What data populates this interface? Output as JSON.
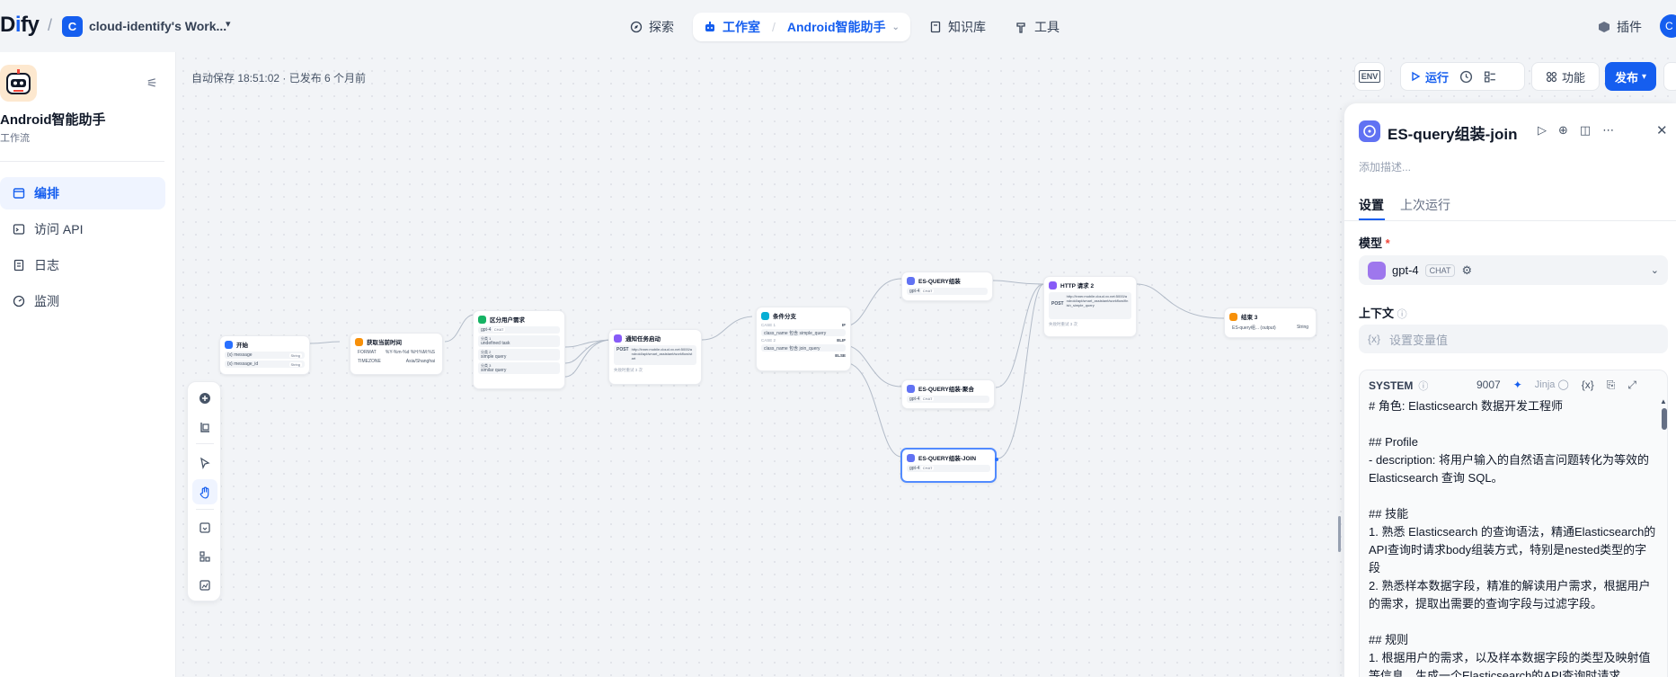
{
  "topbar": {
    "logo": "Dify",
    "workspace_initial": "C",
    "workspace_name": "cloud-identify's Work...",
    "nav": {
      "explore": "探索",
      "studio": "工作室",
      "app": "Android智能助手",
      "knowledge": "知识库",
      "tools": "工具"
    },
    "plugins": "插件",
    "user_initial": "C"
  },
  "sidebar": {
    "app_name": "Android智能助手",
    "app_type": "工作流",
    "items": [
      {
        "label": "编排",
        "active": true
      },
      {
        "label": "访问 API",
        "active": false
      },
      {
        "label": "日志",
        "active": false
      },
      {
        "label": "监测",
        "active": false
      }
    ]
  },
  "canvas": {
    "autosave": "自动保存 18:51:02 · 已发布 6 个月前",
    "actions": {
      "env": "ENV",
      "run": "运行",
      "features": "功能",
      "publish": "发布"
    },
    "nodes": {
      "start": {
        "title": "开始",
        "vars": [
          "message",
          "message_id"
        ],
        "type": "String"
      },
      "time": {
        "title": "获取当前时间",
        "rows": [
          [
            "FORMAT",
            "%Y-%m-%d %H:%M:%S"
          ],
          [
            "TIMEZONE",
            "Asia/Shanghai"
          ]
        ]
      },
      "classify": {
        "title": "区分用户需求",
        "model": "gpt-4",
        "badge": "CHAT",
        "classes": [
          "分类 1",
          "undefined task",
          "分类 2",
          "simple query",
          "分类 3",
          "similar query"
        ]
      },
      "notify": {
        "title": "通知任务启动",
        "method": "POST",
        "url": "http://inner.mobile.cloud.xx.net:5000/android/api/smart_assistant/workflow/start",
        "retry": "失败时重试 3 次"
      },
      "ifelse": {
        "title": "条件分支",
        "case1": "CASE 1",
        "case1_label": "IF",
        "case1_cond": "class_name 包含 simple_query",
        "case2": "CASE 2",
        "case2_label": "ELIF",
        "case2_cond": "class_name 包含 join_query",
        "else": "ELSE"
      },
      "esquery": {
        "title": "ES-QUERY组装",
        "model": "gpt-4",
        "badge": "CHAT"
      },
      "esagg": {
        "title": "ES-QUERY组装-聚合",
        "model": "gpt-4",
        "badge": "CHAT"
      },
      "esjoin": {
        "title": "ES-QUERY组装-JOIN",
        "model": "gpt-4",
        "badge": "CHAT"
      },
      "http2": {
        "title": "HTTP 请求 2",
        "method": "POST",
        "url": "http://inner.mobile.cloud.xx.net:5000/android/api/smart_assistant/workflow/finish_simple_query",
        "retry": "失败时重试 3 次"
      },
      "end": {
        "title": "结束 3",
        "var": "ES-query组... (output)",
        "type": "String"
      }
    }
  },
  "panel": {
    "title": "ES-query组装-join",
    "desc_placeholder": "添加描述...",
    "tabs": [
      "设置",
      "上次运行"
    ],
    "model_label": "模型",
    "model_name": "gpt-4",
    "model_badge": "CHAT",
    "context_label": "上下文",
    "context_placeholder": "设置变量值",
    "context_prefix": "{x}",
    "system_label": "SYSTEM",
    "token_count": "9007",
    "jinja": "Jinja",
    "var_insert": "{x}",
    "system_text": "# 角色: Elasticsearch 数据开发工程师\n\n## Profile\n- description: 将用户输入的自然语言问题转化为等效的 Elasticsearch 查询 SQL。\n\n## 技能\n1. 熟悉 Elasticsearch 的查询语法，精通Elasticsearch的API查询时请求body组装方式，特别是nested类型的字段\n2. 熟悉样本数据字段，精准的解读用户需求，根据用户的需求，提取出需要的查询字段与过滤字段。\n\n## 规则\n1. 根据用户的需求，以及样本数据字段的类型及映射值等信息，生成一个Elasticsearch的API查询时请求"
  },
  "colors": {
    "primary": "#155eef",
    "llm": "#6172f3",
    "start": "#2970ff",
    "http": "#875bf7",
    "code": "#f79009",
    "question": "#16b364"
  }
}
